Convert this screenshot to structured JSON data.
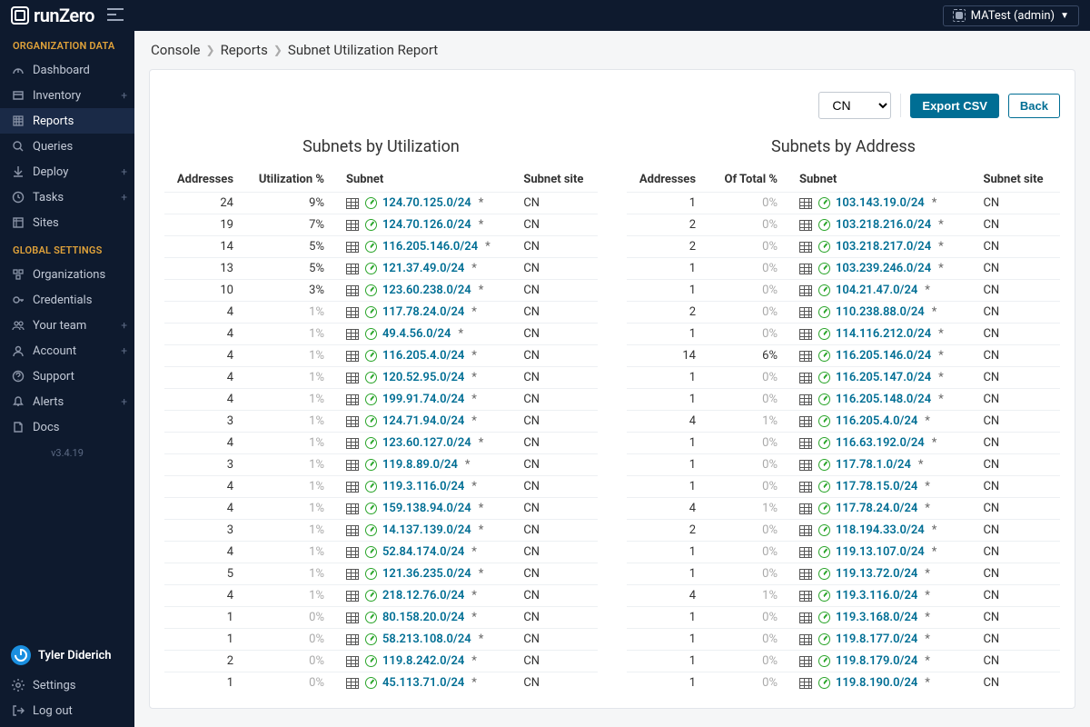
{
  "brand": "runZero",
  "org_switcher": "MATest (admin)",
  "breadcrumbs": [
    "Console",
    "Reports",
    "Subnet Utilization Report"
  ],
  "sidebar": {
    "section1": "ORGANIZATION DATA",
    "section2": "GLOBAL SETTINGS",
    "items1": [
      {
        "label": "Dashboard",
        "plus": false
      },
      {
        "label": "Inventory",
        "plus": true
      },
      {
        "label": "Reports",
        "plus": false,
        "active": true
      },
      {
        "label": "Queries",
        "plus": false
      },
      {
        "label": "Deploy",
        "plus": true
      },
      {
        "label": "Tasks",
        "plus": true
      },
      {
        "label": "Sites",
        "plus": false
      }
    ],
    "items2": [
      {
        "label": "Organizations",
        "plus": false
      },
      {
        "label": "Credentials",
        "plus": false
      },
      {
        "label": "Your team",
        "plus": true
      },
      {
        "label": "Account",
        "plus": true
      },
      {
        "label": "Support",
        "plus": false
      },
      {
        "label": "Alerts",
        "plus": true
      },
      {
        "label": "Docs",
        "plus": false
      }
    ],
    "version": "v3.4.19",
    "user": "Tyler Diderich",
    "settings": "Settings",
    "logout": "Log out"
  },
  "controls": {
    "select_value": "CN",
    "export": "Export CSV",
    "back": "Back"
  },
  "table_left": {
    "title": "Subnets by Utilization",
    "cols": [
      "Addresses",
      "Utilization %",
      "Subnet",
      "Subnet site"
    ],
    "rows": [
      {
        "a": "24",
        "p": "9%",
        "s": "124.70.125.0/24",
        "site": "CN",
        "pz": false
      },
      {
        "a": "19",
        "p": "7%",
        "s": "124.70.126.0/24",
        "site": "CN",
        "pz": false
      },
      {
        "a": "14",
        "p": "5%",
        "s": "116.205.146.0/24",
        "site": "CN",
        "pz": false
      },
      {
        "a": "13",
        "p": "5%",
        "s": "121.37.49.0/24",
        "site": "CN",
        "pz": false
      },
      {
        "a": "10",
        "p": "3%",
        "s": "123.60.238.0/24",
        "site": "CN",
        "pz": false
      },
      {
        "a": "4",
        "p": "1%",
        "s": "117.78.24.0/24",
        "site": "CN",
        "pz": true
      },
      {
        "a": "4",
        "p": "1%",
        "s": "49.4.56.0/24",
        "site": "CN",
        "pz": true
      },
      {
        "a": "4",
        "p": "1%",
        "s": "116.205.4.0/24",
        "site": "CN",
        "pz": true
      },
      {
        "a": "4",
        "p": "1%",
        "s": "120.52.95.0/24",
        "site": "CN",
        "pz": true
      },
      {
        "a": "4",
        "p": "1%",
        "s": "199.91.74.0/24",
        "site": "CN",
        "pz": true
      },
      {
        "a": "3",
        "p": "1%",
        "s": "124.71.94.0/24",
        "site": "CN",
        "pz": true
      },
      {
        "a": "4",
        "p": "1%",
        "s": "123.60.127.0/24",
        "site": "CN",
        "pz": true
      },
      {
        "a": "3",
        "p": "1%",
        "s": "119.8.89.0/24",
        "site": "CN",
        "pz": true
      },
      {
        "a": "4",
        "p": "1%",
        "s": "119.3.116.0/24",
        "site": "CN",
        "pz": true
      },
      {
        "a": "4",
        "p": "1%",
        "s": "159.138.94.0/24",
        "site": "CN",
        "pz": true
      },
      {
        "a": "3",
        "p": "1%",
        "s": "14.137.139.0/24",
        "site": "CN",
        "pz": true
      },
      {
        "a": "4",
        "p": "1%",
        "s": "52.84.174.0/24",
        "site": "CN",
        "pz": true
      },
      {
        "a": "5",
        "p": "1%",
        "s": "121.36.235.0/24",
        "site": "CN",
        "pz": true
      },
      {
        "a": "4",
        "p": "1%",
        "s": "218.12.76.0/24",
        "site": "CN",
        "pz": true
      },
      {
        "a": "1",
        "p": "0%",
        "s": "80.158.20.0/24",
        "site": "CN",
        "pz": true
      },
      {
        "a": "1",
        "p": "0%",
        "s": "58.213.108.0/24",
        "site": "CN",
        "pz": true
      },
      {
        "a": "2",
        "p": "0%",
        "s": "119.8.242.0/24",
        "site": "CN",
        "pz": true
      },
      {
        "a": "1",
        "p": "0%",
        "s": "45.113.71.0/24",
        "site": "CN",
        "pz": true
      }
    ]
  },
  "table_right": {
    "title": "Subnets by Address",
    "cols": [
      "Addresses",
      "Of Total %",
      "Subnet",
      "Subnet site"
    ],
    "rows": [
      {
        "a": "1",
        "p": "0%",
        "s": "103.143.19.0/24",
        "site": "CN",
        "pz": true
      },
      {
        "a": "2",
        "p": "0%",
        "s": "103.218.216.0/24",
        "site": "CN",
        "pz": true
      },
      {
        "a": "2",
        "p": "0%",
        "s": "103.218.217.0/24",
        "site": "CN",
        "pz": true
      },
      {
        "a": "1",
        "p": "0%",
        "s": "103.239.246.0/24",
        "site": "CN",
        "pz": true
      },
      {
        "a": "1",
        "p": "0%",
        "s": "104.21.47.0/24",
        "site": "CN",
        "pz": true
      },
      {
        "a": "2",
        "p": "0%",
        "s": "110.238.88.0/24",
        "site": "CN",
        "pz": true
      },
      {
        "a": "1",
        "p": "0%",
        "s": "114.116.212.0/24",
        "site": "CN",
        "pz": true
      },
      {
        "a": "14",
        "p": "6%",
        "s": "116.205.146.0/24",
        "site": "CN",
        "pz": false
      },
      {
        "a": "1",
        "p": "0%",
        "s": "116.205.147.0/24",
        "site": "CN",
        "pz": true
      },
      {
        "a": "1",
        "p": "0%",
        "s": "116.205.148.0/24",
        "site": "CN",
        "pz": true
      },
      {
        "a": "4",
        "p": "1%",
        "s": "116.205.4.0/24",
        "site": "CN",
        "pz": true
      },
      {
        "a": "1",
        "p": "0%",
        "s": "116.63.192.0/24",
        "site": "CN",
        "pz": true
      },
      {
        "a": "1",
        "p": "0%",
        "s": "117.78.1.0/24",
        "site": "CN",
        "pz": true
      },
      {
        "a": "1",
        "p": "0%",
        "s": "117.78.15.0/24",
        "site": "CN",
        "pz": true
      },
      {
        "a": "4",
        "p": "1%",
        "s": "117.78.24.0/24",
        "site": "CN",
        "pz": true
      },
      {
        "a": "2",
        "p": "0%",
        "s": "118.194.33.0/24",
        "site": "CN",
        "pz": true
      },
      {
        "a": "1",
        "p": "0%",
        "s": "119.13.107.0/24",
        "site": "CN",
        "pz": true
      },
      {
        "a": "1",
        "p": "0%",
        "s": "119.13.72.0/24",
        "site": "CN",
        "pz": true
      },
      {
        "a": "4",
        "p": "1%",
        "s": "119.3.116.0/24",
        "site": "CN",
        "pz": true
      },
      {
        "a": "1",
        "p": "0%",
        "s": "119.3.168.0/24",
        "site": "CN",
        "pz": true
      },
      {
        "a": "1",
        "p": "0%",
        "s": "119.8.177.0/24",
        "site": "CN",
        "pz": true
      },
      {
        "a": "1",
        "p": "0%",
        "s": "119.8.179.0/24",
        "site": "CN",
        "pz": true
      },
      {
        "a": "1",
        "p": "0%",
        "s": "119.8.190.0/24",
        "site": "CN",
        "pz": true
      }
    ]
  }
}
